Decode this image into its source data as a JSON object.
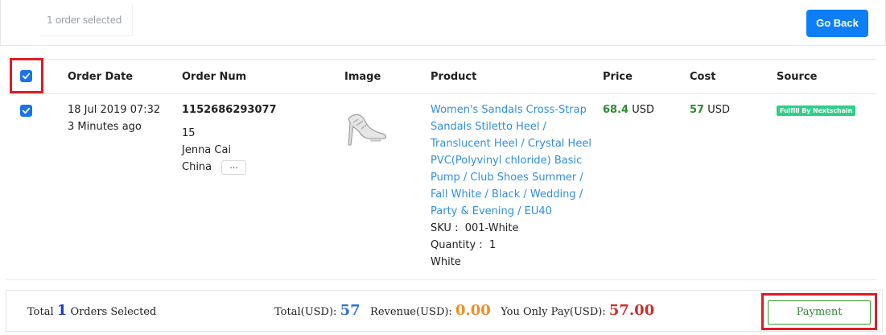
{
  "toolbar": {
    "selected_text": "1 order selected",
    "go_back_label": "Go Back"
  },
  "table": {
    "headers": {
      "order_date": "Order Date",
      "order_num": "Order Num",
      "image": "Image",
      "product": "Product",
      "price": "Price",
      "cost": "Cost",
      "source": "Source"
    },
    "row": {
      "selected": true,
      "order_date": "18 Jul 2019 07:32",
      "time_ago": "3 Minutes ago",
      "order_num": "1152686293077",
      "order_sub": "15",
      "customer": "Jenna Cai",
      "country": "China",
      "more_label": "...",
      "product_lines": [
        "Women's Sandals Cross-Strap",
        "Sandals Stiletto Heel /",
        "Translucent Heel / Crystal Heel",
        "PVC(Polyvinyl chloride) Basic",
        "Pump / Club Shoes Summer /",
        "Fall White / Black / Wedding /",
        "Party & Evening / EU40"
      ],
      "sku_label": "SKU :",
      "sku_value": "001-White",
      "quantity_label": "Quantity :",
      "quantity_value": "1",
      "variant": "White",
      "price_value": "68.4",
      "price_currency": "USD",
      "cost_value": "57",
      "cost_currency": "USD",
      "source_badge": "Fulfill By Nextschain"
    }
  },
  "footer": {
    "total_prefix": "Total",
    "total_count": "1",
    "total_suffix": "Orders Selected",
    "total_usd_label": "Total(USD):",
    "total_usd_value": "57",
    "revenue_label": "Revenue(USD):",
    "revenue_value": "0.00",
    "pay_label": "You Only Pay(USD):",
    "pay_value": "57.00",
    "payment_label": "Payment"
  },
  "colors": {
    "accent": "#0d7ef5",
    "highlight": "#e01b24",
    "link": "#2f8fe0",
    "badge": "#2fcf8a"
  }
}
